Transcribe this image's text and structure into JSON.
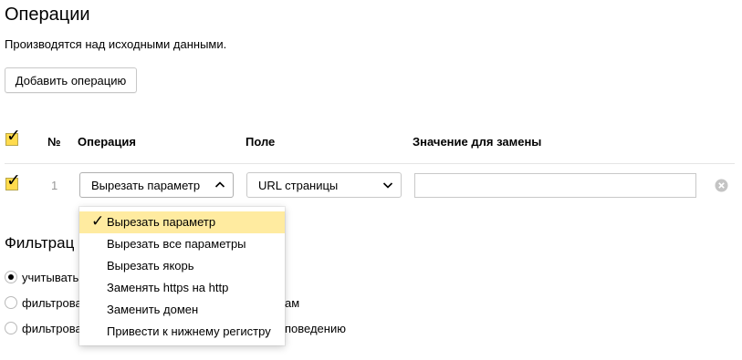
{
  "section": {
    "title": "Операции",
    "description": "Производятся над исходными данными.",
    "add_button_label": "Добавить операцию"
  },
  "table": {
    "headers": {
      "num": "№",
      "operation": "Операция",
      "field": "Поле",
      "replacement_value": "Значение для замены"
    },
    "rows": [
      {
        "checked": true,
        "num": "1",
        "operation": "Вырезать параметр",
        "field": "URL страницы",
        "replacement_value": ""
      }
    ]
  },
  "dropdown": {
    "open": true,
    "items": [
      {
        "label": "Вырезать параметр",
        "selected": true
      },
      {
        "label": "Вырезать все параметры",
        "selected": false
      },
      {
        "label": "Вырезать якорь",
        "selected": false
      },
      {
        "label": "Заменять https на http",
        "selected": false
      },
      {
        "label": "Заменить домен",
        "selected": false
      },
      {
        "label": "Привести к нижнему регистру",
        "selected": false
      }
    ]
  },
  "filters": {
    "title_visible": "Фильтрац",
    "options": [
      {
        "label_visible": "учитывать",
        "tail_visible": "",
        "checked": true
      },
      {
        "label_visible": "фильтровать",
        "tail_visible": "ам",
        "checked": false
      },
      {
        "label_visible": "фильтровать",
        "tail_visible": "поведению",
        "checked": false
      }
    ]
  },
  "icons": {
    "checkmark": "checkmark-icon",
    "chevron_up": "chevron-up-icon",
    "chevron_down": "chevron-down-icon",
    "remove": "close-circle-icon"
  },
  "colors": {
    "checkbox_fill": "#ffdb4d",
    "selected_item_bg": "#ffeba0",
    "border": "#c8c8c8",
    "muted_text": "#999999"
  }
}
